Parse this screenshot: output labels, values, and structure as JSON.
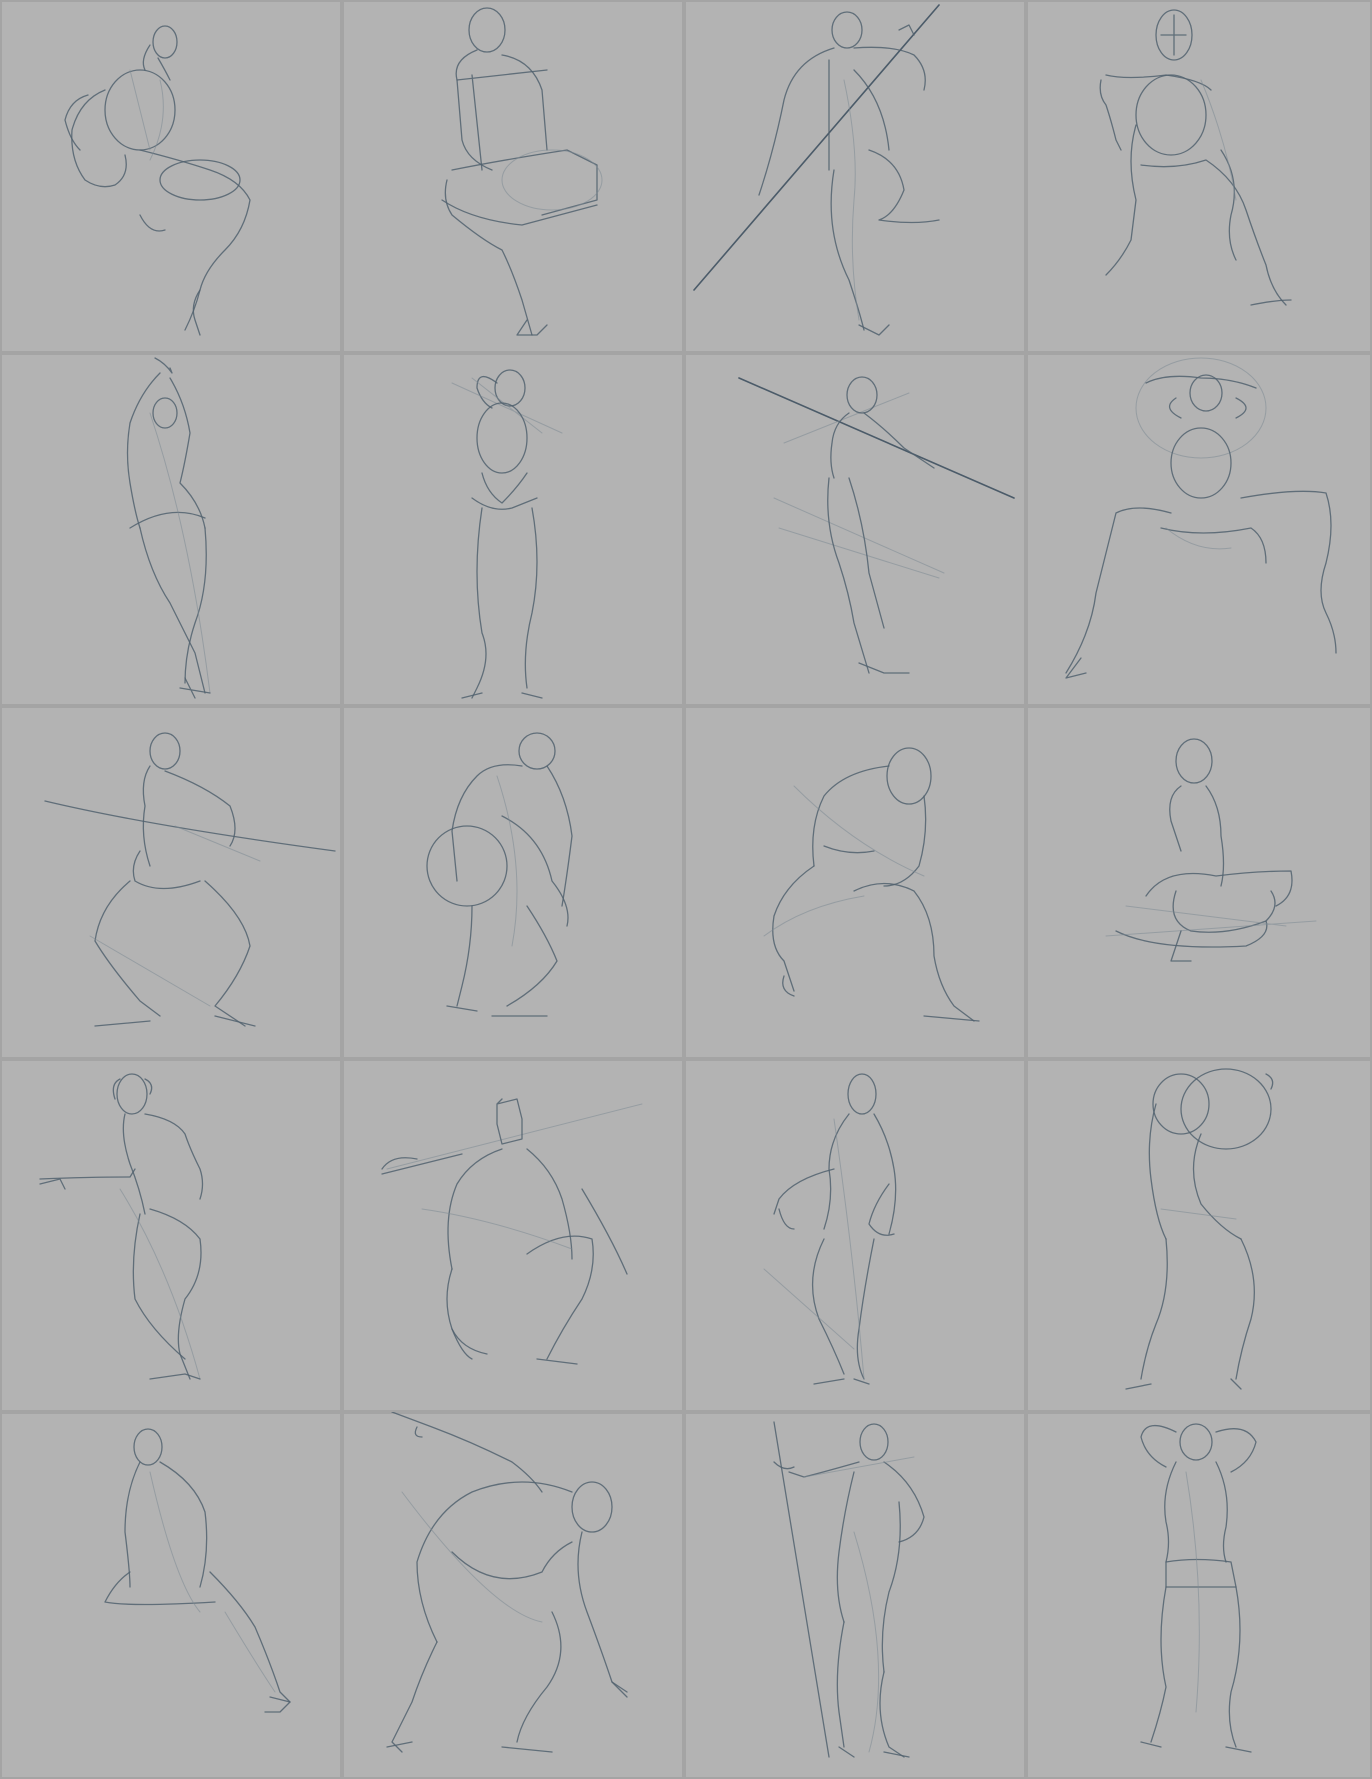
{
  "sheet": {
    "background": "#a3a3a3",
    "panel_color": "#b3b3b3",
    "line_color": "#51616e",
    "columns": 4,
    "rows": 5
  },
  "poses": [
    {
      "name": "seated-leg-raised"
    },
    {
      "name": "seated-on-box-back-view"
    },
    {
      "name": "standing-with-staff-diagonal"
    },
    {
      "name": "seated-holding-object"
    },
    {
      "name": "standing-arm-overhead"
    },
    {
      "name": "standing-back-view-hand-on-head"
    },
    {
      "name": "standing-arm-extended-with-line"
    },
    {
      "name": "seated-legs-spread-arms-up"
    },
    {
      "name": "squatting-with-staff"
    },
    {
      "name": "crouching-back-view"
    },
    {
      "name": "lunging-forward"
    },
    {
      "name": "kneeling-seated-on-floor"
    },
    {
      "name": "stepping-arm-pointing"
    },
    {
      "name": "crouching-with-box-head-line"
    },
    {
      "name": "standing-contrapposto-arm-bent"
    },
    {
      "name": "standing-arms-raised-behind-head"
    },
    {
      "name": "kneeling-back-view"
    },
    {
      "name": "bending-forward-reaching"
    },
    {
      "name": "standing-holding-staff"
    },
    {
      "name": "standing-hands-behind-head"
    }
  ]
}
